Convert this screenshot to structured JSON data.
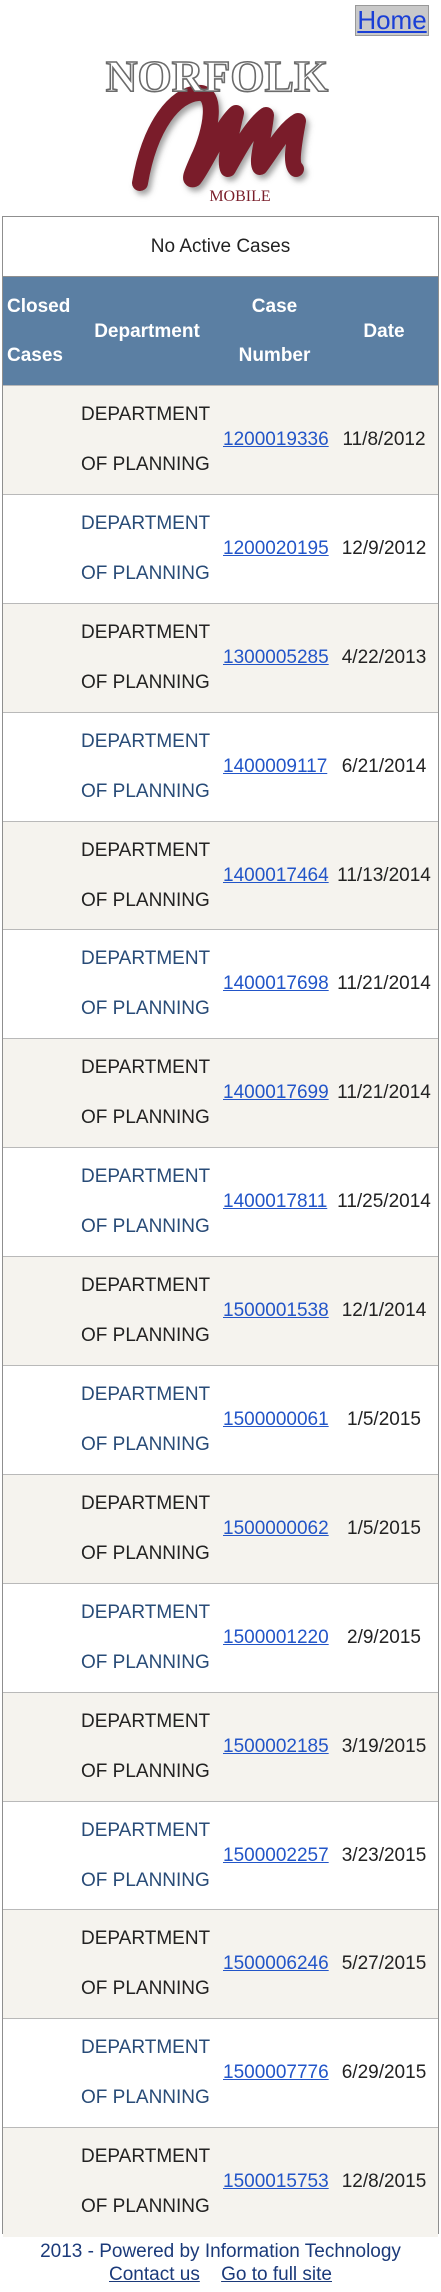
{
  "header": {
    "home_label": "Home",
    "logo": {
      "title": "NORFOLK",
      "subtitle": "MOBILE",
      "accent_color": "#7a1e2a"
    }
  },
  "status": {
    "no_active_cases": "No Active Cases"
  },
  "table": {
    "headers": {
      "closed_line1": "Closed",
      "closed_line2": "Cases",
      "department": "Department",
      "case_line1": "Case",
      "case_line2": "Number",
      "date": "Date"
    },
    "rows": [
      {
        "dept_line1": "DEPARTMENT",
        "dept_line2": "OF PLANNING",
        "case": "1200019336",
        "date": "11/8/2012"
      },
      {
        "dept_line1": "DEPARTMENT",
        "dept_line2": "OF PLANNING",
        "case": "1200020195",
        "date": "12/9/2012"
      },
      {
        "dept_line1": "DEPARTMENT",
        "dept_line2": "OF PLANNING",
        "case": "1300005285",
        "date": "4/22/2013"
      },
      {
        "dept_line1": "DEPARTMENT",
        "dept_line2": "OF PLANNING",
        "case": "1400009117",
        "date": "6/21/2014"
      },
      {
        "dept_line1": "DEPARTMENT",
        "dept_line2": "OF PLANNING",
        "case": "1400017464",
        "date": "11/13/2014"
      },
      {
        "dept_line1": "DEPARTMENT",
        "dept_line2": "OF PLANNING",
        "case": "1400017698",
        "date": "11/21/2014"
      },
      {
        "dept_line1": "DEPARTMENT",
        "dept_line2": "OF PLANNING",
        "case": "1400017699",
        "date": "11/21/2014"
      },
      {
        "dept_line1": "DEPARTMENT",
        "dept_line2": "OF PLANNING",
        "case": "1400017811",
        "date": "11/25/2014"
      },
      {
        "dept_line1": "DEPARTMENT",
        "dept_line2": "OF PLANNING",
        "case": "1500001538",
        "date": "12/1/2014"
      },
      {
        "dept_line1": "DEPARTMENT",
        "dept_line2": "OF PLANNING",
        "case": "1500000061",
        "date": "1/5/2015"
      },
      {
        "dept_line1": "DEPARTMENT",
        "dept_line2": "OF PLANNING",
        "case": "1500000062",
        "date": "1/5/2015"
      },
      {
        "dept_line1": "DEPARTMENT",
        "dept_line2": "OF PLANNING",
        "case": "1500001220",
        "date": "2/9/2015"
      },
      {
        "dept_line1": "DEPARTMENT",
        "dept_line2": "OF PLANNING",
        "case": "1500002185",
        "date": "3/19/2015"
      },
      {
        "dept_line1": "DEPARTMENT",
        "dept_line2": "OF PLANNING",
        "case": "1500002257",
        "date": "3/23/2015"
      },
      {
        "dept_line1": "DEPARTMENT",
        "dept_line2": "OF PLANNING",
        "case": "1500006246",
        "date": "5/27/2015"
      },
      {
        "dept_line1": "DEPARTMENT",
        "dept_line2": "OF PLANNING",
        "case": "1500007776",
        "date": "6/29/2015"
      },
      {
        "dept_line1": "DEPARTMENT",
        "dept_line2": "OF PLANNING",
        "case": "1500015753",
        "date": "12/8/2015"
      }
    ]
  },
  "footer": {
    "powered_by": "2013 - Powered by Information Technology",
    "contact_label": "Contact us",
    "full_site_label": "Go to full site"
  }
}
